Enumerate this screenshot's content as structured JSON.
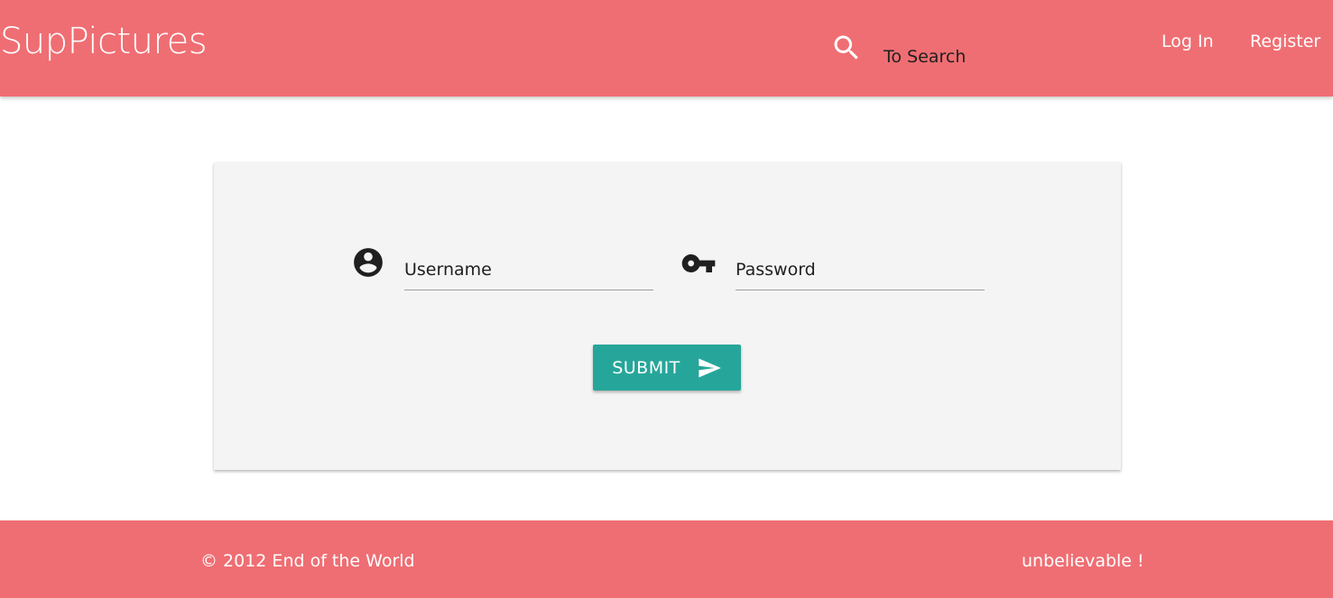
{
  "header": {
    "brand": "SupPictures",
    "search_placeholder": "To Search",
    "search_icon": "search-icon",
    "nav": {
      "login": "Log In",
      "register": "Register"
    }
  },
  "login_form": {
    "username_placeholder": "Username",
    "username_icon": "account-circle-icon",
    "password_placeholder": "Password",
    "password_icon": "key-icon",
    "submit_label": "SUBMIT",
    "submit_icon": "send-icon"
  },
  "footer": {
    "copyright": "© 2012 End of the World",
    "link": "unbelievable !"
  },
  "colors": {
    "primary": "#ef6e73",
    "accent": "#26a69a",
    "card_background": "#f4f4f4"
  }
}
